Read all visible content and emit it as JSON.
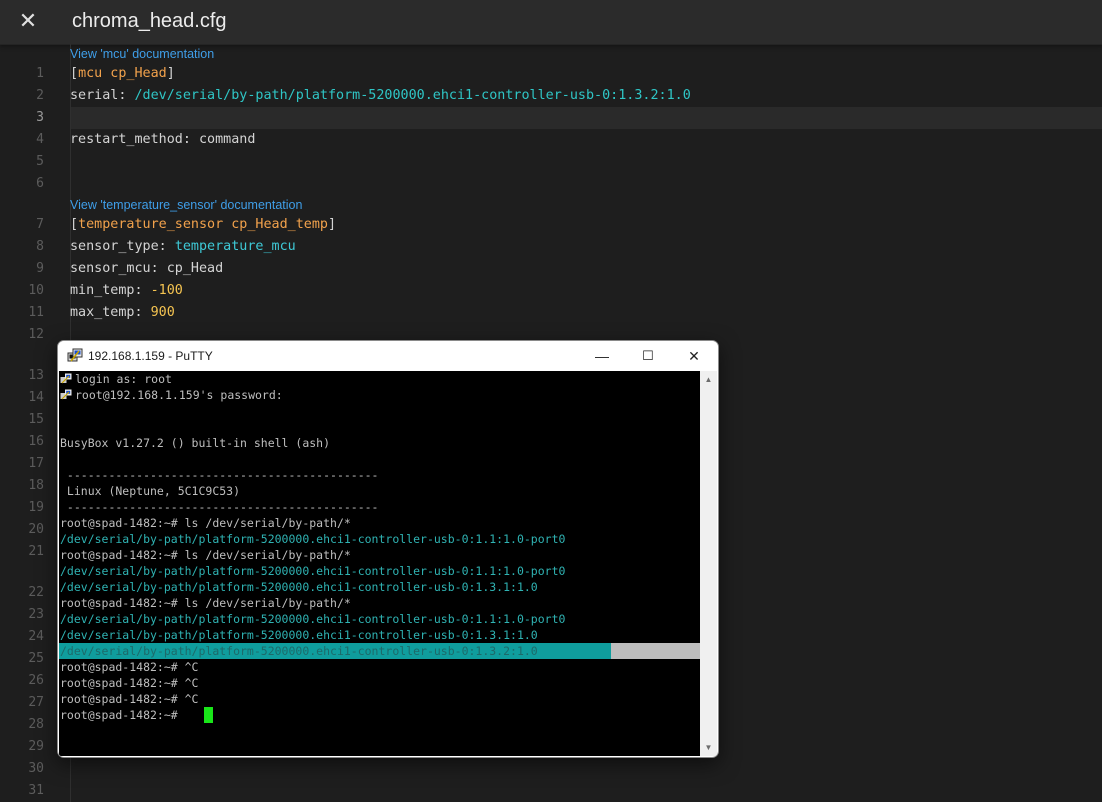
{
  "editor": {
    "title": "chroma_head.cfg",
    "doc_links": {
      "mcu": "View 'mcu' documentation",
      "temperature_sensor": "View 'temperature_sensor' documentation"
    },
    "line_numbers": [
      "1",
      "2",
      "3",
      "4",
      "5",
      "6",
      "7",
      "8",
      "9",
      "10",
      "11",
      "12",
      "13",
      "14",
      "15",
      "16",
      "17",
      "18",
      "19",
      "20",
      "21",
      "22",
      "23",
      "24",
      "25",
      "26",
      "27",
      "28",
      "29",
      "30",
      "31"
    ],
    "code": {
      "l1_open": "[",
      "l1_section": "mcu cp_Head",
      "l1_close": "]",
      "l2_key": "serial: ",
      "l2_value": "/dev/serial/by-path/platform-5200000.ehci1-controller-usb-0:1.3.2:1.0",
      "l4": "restart_method: command",
      "l7_open": "[",
      "l7_section": "temperature_sensor cp_Head_temp",
      "l7_close": "]",
      "l8_key": "sensor_type: ",
      "l8_value": "temperature_mcu",
      "l9": "sensor_mcu: cp_Head",
      "l10_key": "min_temp: ",
      "l10_value": "-100",
      "l11_key": "max_temp: ",
      "l11_value": "900"
    }
  },
  "putty": {
    "title": "192.168.1.159 - PuTTY",
    "buttons": {
      "minimize": "—",
      "maximize": "☐",
      "close": "✕"
    },
    "terminal": [
      "login as: root",
      "root@192.168.1.159's password:",
      "",
      "BusyBox v1.27.2 () built-in shell (ash)",
      "",
      " ---------------------------------------------",
      " Linux (Neptune, 5C1C9C53)",
      " ---------------------------------------------",
      "root@spad-1482:~# ls /dev/serial/by-path/*",
      "/dev/serial/by-path/platform-5200000.ehci1-controller-usb-0:1.1:1.0-port0",
      "root@spad-1482:~# ls /dev/serial/by-path/*",
      "/dev/serial/by-path/platform-5200000.ehci1-controller-usb-0:1.1:1.0-port0",
      "/dev/serial/by-path/platform-5200000.ehci1-controller-usb-0:1.3.1:1.0",
      "root@spad-1482:~# ls /dev/serial/by-path/*",
      "/dev/serial/by-path/platform-5200000.ehci1-controller-usb-0:1.1:1.0-port0",
      "/dev/serial/by-path/platform-5200000.ehci1-controller-usb-0:1.3.1:1.0",
      "/dev/serial/by-path/platform-5200000.ehci1-controller-usb-0:1.3.2:1.0",
      "root@spad-1482:~# ^C",
      "root@spad-1482:~# ^C",
      "root@spad-1482:~# ^C",
      "root@spad-1482:~# "
    ]
  },
  "colors": {
    "editor_bg": "#1e1e1e",
    "section": "#f2a24c",
    "path": "#2fc6c6",
    "number": "#f5c451",
    "link": "#3f9ee8",
    "terminal_path": "#2fb3b3",
    "cursor": "#19e619"
  }
}
